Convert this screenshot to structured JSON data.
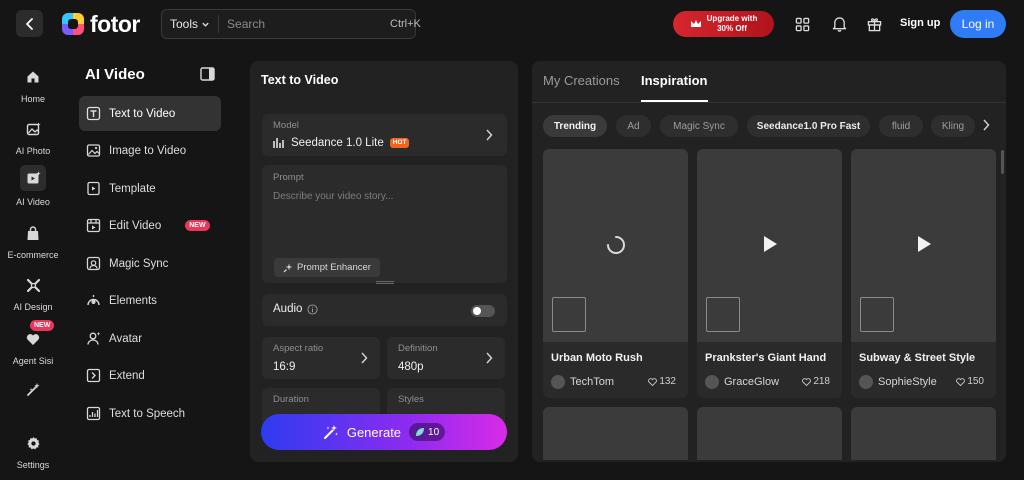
{
  "header": {
    "logo_text": "fotor",
    "tools_label": "Tools",
    "search_placeholder": "Search",
    "search_shortcut": "Ctrl+K",
    "upgrade_line1": "Upgrade with",
    "upgrade_line2": "30% Off",
    "signup_label": "Sign up",
    "login_label": "Log in"
  },
  "rail": {
    "items": [
      {
        "label": "Home"
      },
      {
        "label": "AI Photo"
      },
      {
        "label": "AI Video"
      },
      {
        "label": "E-commerce"
      },
      {
        "label": "AI Design"
      },
      {
        "label": "Agent Sisi",
        "badge": "NEW"
      },
      {
        "label": "Settings"
      }
    ]
  },
  "menu": {
    "title": "AI Video",
    "items": [
      {
        "label": "Text to Video"
      },
      {
        "label": "Image to Video"
      },
      {
        "label": "Template"
      },
      {
        "label": "Edit Video",
        "badge": "NEW"
      },
      {
        "label": "Magic Sync"
      },
      {
        "label": "Elements"
      },
      {
        "label": "Avatar"
      },
      {
        "label": "Extend"
      },
      {
        "label": "Text to Speech"
      }
    ]
  },
  "form": {
    "title": "Text to Video",
    "model_label": "Model",
    "model_value": "Seedance 1.0 Lite",
    "model_badge": "HOT",
    "prompt_label": "Prompt",
    "prompt_placeholder": "Describe your video story...",
    "enhancer_label": "Prompt Enhancer",
    "audio_label": "Audio",
    "aspect_label": "Aspect ratio",
    "aspect_value": "16:9",
    "definition_label": "Definition",
    "definition_value": "480p",
    "duration_label": "Duration",
    "styles_label": "Styles",
    "generate_label": "Generate",
    "generate_credits": "10"
  },
  "right": {
    "tabs": [
      "My Creations",
      "Inspiration"
    ],
    "chips": [
      "Trending",
      "Ad",
      "Magic Sync",
      "Seedance1.0 Pro Fast",
      "fluid",
      "Kling"
    ],
    "cards": [
      {
        "title": "Urban Moto Rush",
        "author": "TechTom",
        "likes": "132"
      },
      {
        "title": "Prankster's Giant Hand",
        "author": "GraceGlow",
        "likes": "218"
      },
      {
        "title": "Subway & Street Style",
        "author": "SophieStyle",
        "likes": "150"
      }
    ]
  },
  "colors": {
    "background": "#151515",
    "panel": "#222222",
    "accent_blue": "#2f7cf6",
    "upgrade_red": "#d7262e",
    "new_badge": "#e8375b",
    "hot_badge": "#f0641e"
  }
}
